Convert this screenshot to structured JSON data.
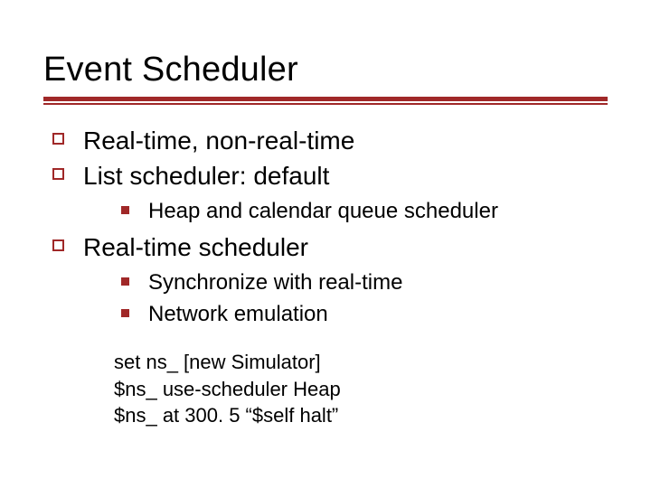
{
  "title": "Event Scheduler",
  "items": [
    {
      "text": "Real-time, non-real-time"
    },
    {
      "text": "List scheduler: default",
      "sub": [
        {
          "text": "Heap and calendar queue scheduler"
        }
      ]
    },
    {
      "text": "Real-time scheduler",
      "sub": [
        {
          "text": "Synchronize with real-time"
        },
        {
          "text": "Network emulation"
        }
      ]
    }
  ],
  "code": {
    "line1": "set ns_ [new Simulator]",
    "line2": "$ns_ use-scheduler Heap",
    "line3": "$ns_ at 300. 5 “$self halt”"
  }
}
